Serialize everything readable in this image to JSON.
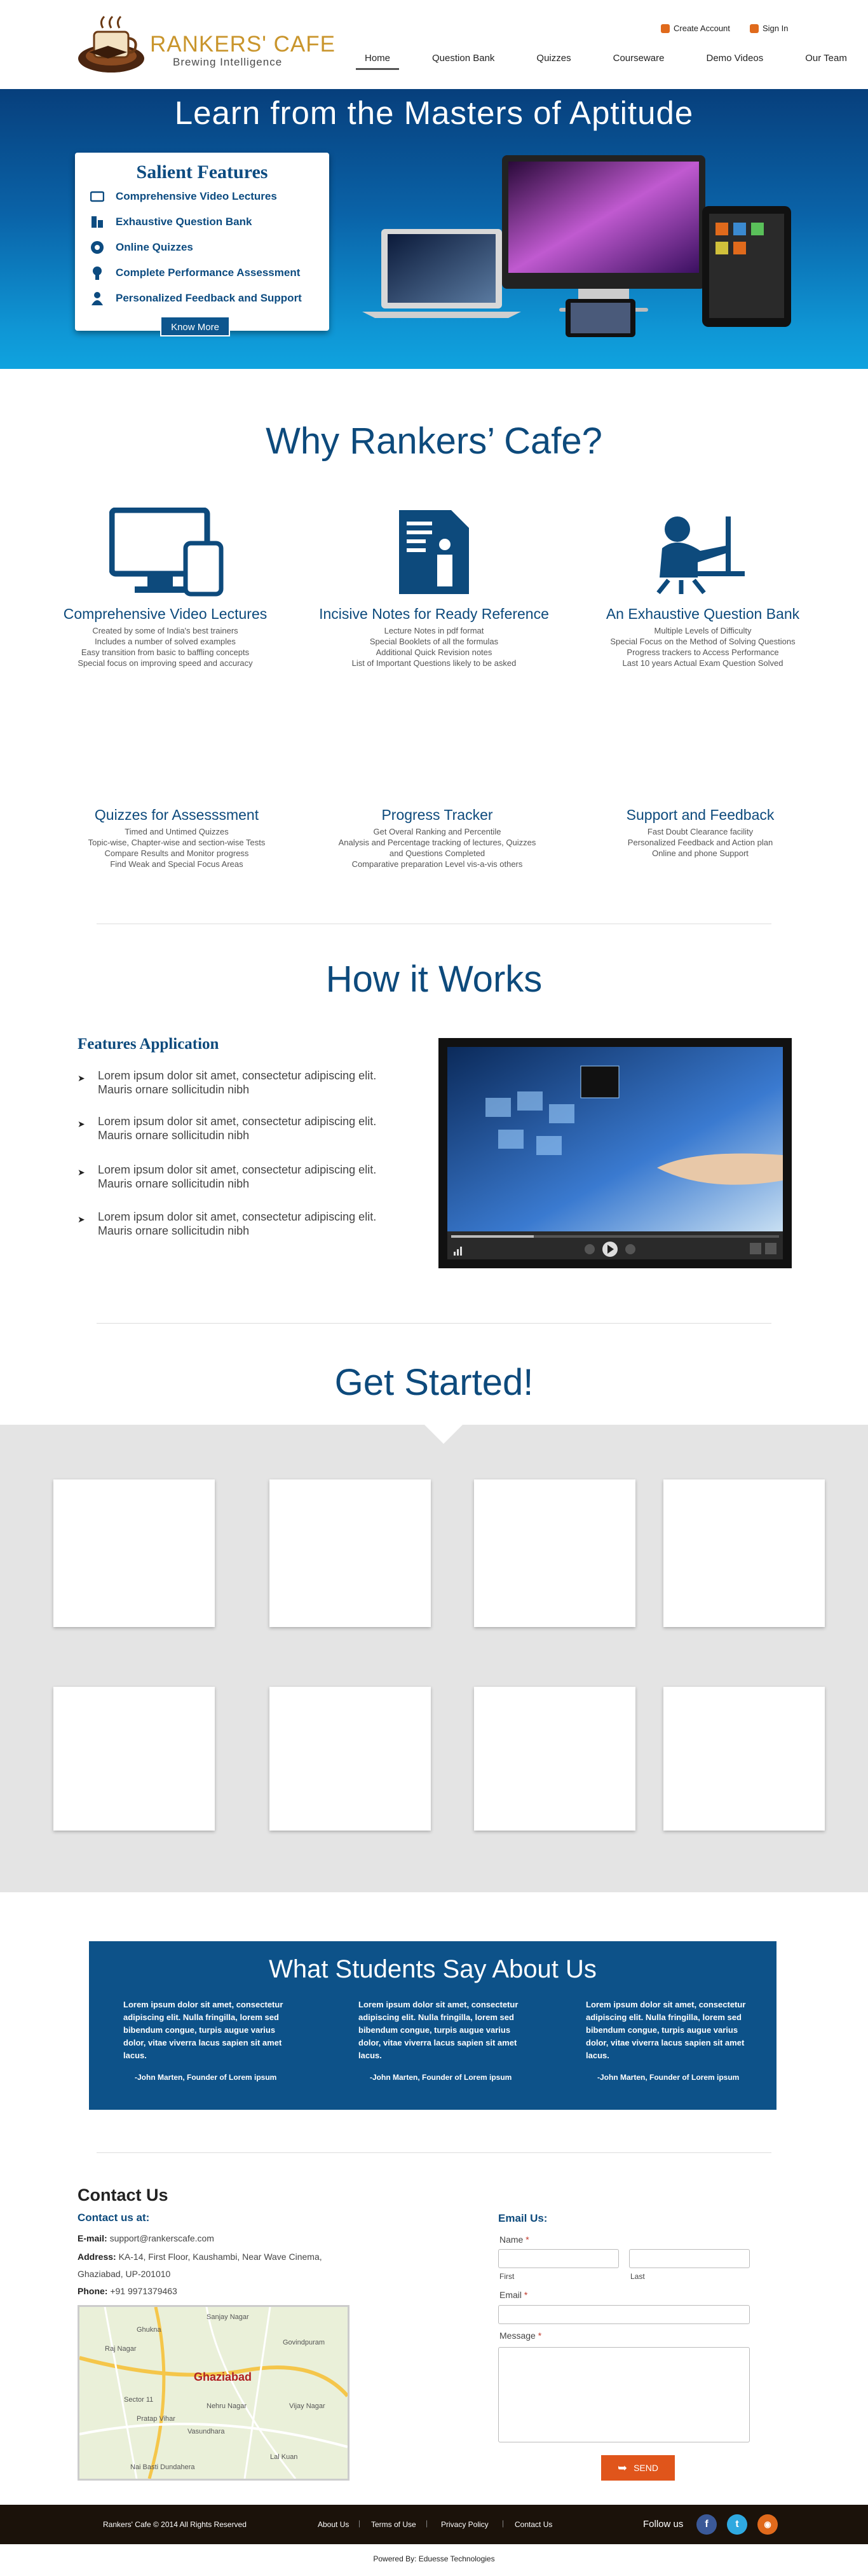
{
  "header": {
    "brand_name": "RANKERS' CAFE",
    "tagline": "Brewing Intelligence",
    "create_account": "Create Account",
    "sign_in": "Sign In",
    "nav": [
      "Home",
      "Question Bank",
      "Quizzes",
      "Courseware",
      "Demo Videos",
      "Our Team"
    ],
    "active_nav": "Home"
  },
  "hero": {
    "title": "Learn from the Masters of Aptitude",
    "box_title": "Salient Features",
    "features": [
      {
        "icon": "video-icon",
        "label": "Comprehensive Video Lectures"
      },
      {
        "icon": "questions-icon",
        "label": "Exhaustive Question Bank"
      },
      {
        "icon": "quiz-icon",
        "label": "Online Quizzes"
      },
      {
        "icon": "assessment-icon",
        "label": "Complete Performance Assessment"
      },
      {
        "icon": "person-icon",
        "label": "Personalized Feedback and Support"
      }
    ],
    "know_more": "Know More"
  },
  "why": {
    "title": "Why Rankers’ Cafe?",
    "features": [
      {
        "title": "Comprehensive Video Lectures",
        "lines": [
          "Created by some of India's best trainers",
          "Includes a number of solved  examples",
          "Easy transition from basic to baffling concepts",
          "Special focus on improving speed and accuracy"
        ]
      },
      {
        "title": "Incisive Notes for Ready Reference",
        "lines": [
          "Lecture Notes in pdf format",
          "Special Booklets  of all the formulas",
          "Additional  Quick  Revision notes",
          "List of Important Questions likely to be asked"
        ]
      },
      {
        "title": "An Exhaustive Question Bank",
        "lines": [
          "Multiple Levels of Difficulty",
          "Special Focus on the Method of Solving Questions",
          "Progress trackers to Access Performance",
          "Last 10 years Actual Exam Question Solved"
        ]
      },
      {
        "title": "Quizzes for Assesssment",
        "lines": [
          "Timed and Untimed  Quizzes",
          "Topic-wise, Chapter-wise and section-wise Tests",
          "Compare Results and Monitor progress",
          "Find Weak and Special Focus Areas"
        ]
      },
      {
        "title": "Progress Tracker",
        "lines": [
          "Get Overal Ranking and Percentile",
          "Analysis and Percentage tracking of lectures, Quizzes",
          "and Questions Completed",
          "Comparative preparation Level vis-a-vis others"
        ]
      },
      {
        "title": "Support and Feedback",
        "lines": [
          "Fast Doubt Clearance facility",
          "Personalized Feedback and Action plan",
          "Online and phone Support"
        ]
      }
    ]
  },
  "how": {
    "title": "How it Works",
    "subtitle": "Features Application",
    "items": [
      "Lorem ipsum dolor sit amet, consectetur adipiscing elit. Mauris ornare sollicitudin nibh",
      "Lorem ipsum dolor sit amet, consectetur adipiscing elit. Mauris ornare sollicitudin nibh",
      "Lorem ipsum dolor sit amet, consectetur adipiscing elit. Mauris ornare sollicitudin nibh",
      "Lorem ipsum dolor sit amet, consectetur adipiscing elit. Mauris ornare sollicitudin nibh"
    ]
  },
  "get_started": {
    "title": "Get Started!"
  },
  "testimonials": {
    "title": "What Students Say About Us",
    "items": [
      {
        "text": "Lorem ipsum dolor sit amet, consectetur adipiscing elit. Nulla fringilla, lorem sed bibendum congue, turpis augue varius dolor, vitae viverra lacus sapien sit amet lacus.",
        "author": "-John Marten, Founder of Lorem ipsum"
      },
      {
        "text": "Lorem ipsum dolor sit amet, consectetur adipiscing elit. Nulla fringilla, lorem sed bibendum congue, turpis augue varius dolor, vitae viverra lacus sapien sit amet lacus.",
        "author": "-John Marten, Founder of Lorem ipsum"
      },
      {
        "text": "Lorem ipsum dolor sit amet, consectetur adipiscing elit. Nulla fringilla, lorem sed bibendum congue, turpis augue varius dolor, vitae viverra lacus sapien sit amet lacus.",
        "author": "-John Marten, Founder of Lorem ipsum"
      }
    ]
  },
  "contact": {
    "title": "Contact Us",
    "subtitle": "Contact us at:",
    "email_label": "E-mail:",
    "email": "support@rankerscafe.com",
    "address_label": "Address:",
    "address_line1": "KA-14, First Floor, Kaushambi, Near Wave Cinema,",
    "address_line2": "Ghaziabad, UP-201010",
    "phone_label": "Phone:",
    "phone": "+91 9971379463",
    "map_city": "Ghaziabad",
    "map_places": [
      "Ghukna",
      "Sanjay Nagar",
      "Raj Nagar",
      "Govindpuram",
      "Sector 11",
      "Nehru Nagar",
      "Pratap Vihar",
      "Vasundhara",
      "Nai Basti Dundahera",
      "Lal Kuan",
      "Vijay Nagar"
    ]
  },
  "form": {
    "title": "Email Us:",
    "name_label": "Name",
    "first_label": "First",
    "last_label": "Last",
    "email_label": "Email",
    "message_label": "Message",
    "required_mark": "*",
    "send": "SEND"
  },
  "footer": {
    "copyright": "Rankers' Cafe © 2014 All Rights Reserved",
    "links": [
      "About Us",
      "Terms of Use",
      "Privacy Policy",
      "Contact Us"
    ],
    "follow": "Follow us",
    "social": [
      {
        "icon": "facebook-icon",
        "glyph": "f",
        "color": "#3b5998"
      },
      {
        "icon": "twitter-icon",
        "glyph": "t",
        "color": "#2fa9e0"
      },
      {
        "icon": "rss-icon",
        "glyph": "◉",
        "color": "#e06a1c"
      }
    ],
    "powered_by": "Powered By: Eduesse Technologies"
  }
}
